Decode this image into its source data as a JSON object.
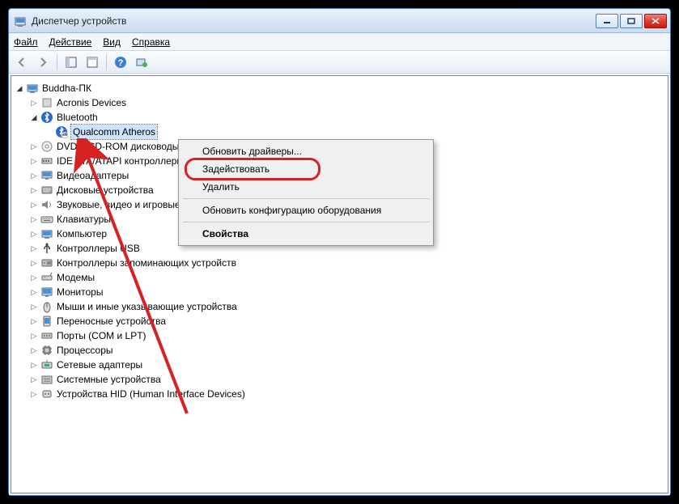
{
  "window": {
    "title": "Диспетчер устройств"
  },
  "menu": {
    "file": "Файл",
    "action": "Действие",
    "view": "Вид",
    "help": "Справка"
  },
  "tree": {
    "root": "Buddha-ПК",
    "items": [
      {
        "label": "Acronis Devices",
        "icon": "generic"
      },
      {
        "label": "Bluetooth",
        "icon": "bluetooth",
        "expanded": true,
        "children": [
          {
            "label": "Qualcomm Atheros",
            "icon": "bluetooth-disabled",
            "selected": true
          }
        ]
      },
      {
        "label": "DVD и CD-ROM дисководы",
        "icon": "cdrom"
      },
      {
        "label": "IDE ATA/ATAPI контроллеры",
        "icon": "ide"
      },
      {
        "label": "Видеоадаптеры",
        "icon": "display"
      },
      {
        "label": "Дисковые устройства",
        "icon": "disk"
      },
      {
        "label": "Звуковые, видео и игровые устройства",
        "icon": "sound"
      },
      {
        "label": "Клавиатуры",
        "icon": "keyboard"
      },
      {
        "label": "Компьютер",
        "icon": "computer"
      },
      {
        "label": "Контроллеры USB",
        "icon": "usb"
      },
      {
        "label": "Контроллеры запоминающих устройств",
        "icon": "storage"
      },
      {
        "label": "Модемы",
        "icon": "modem"
      },
      {
        "label": "Мониторы",
        "icon": "monitor"
      },
      {
        "label": "Мыши и иные указывающие устройства",
        "icon": "mouse"
      },
      {
        "label": "Переносные устройства",
        "icon": "portable"
      },
      {
        "label": "Порты (COM и LPT)",
        "icon": "port"
      },
      {
        "label": "Процессоры",
        "icon": "cpu"
      },
      {
        "label": "Сетевые адаптеры",
        "icon": "network"
      },
      {
        "label": "Системные устройства",
        "icon": "system"
      },
      {
        "label": "Устройства HID (Human Interface Devices)",
        "icon": "hid"
      }
    ]
  },
  "context_menu": {
    "update_drivers": "Обновить драйверы...",
    "enable": "Задействовать",
    "delete": "Удалить",
    "scan": "Обновить конфигурацию оборудования",
    "properties": "Свойства"
  }
}
